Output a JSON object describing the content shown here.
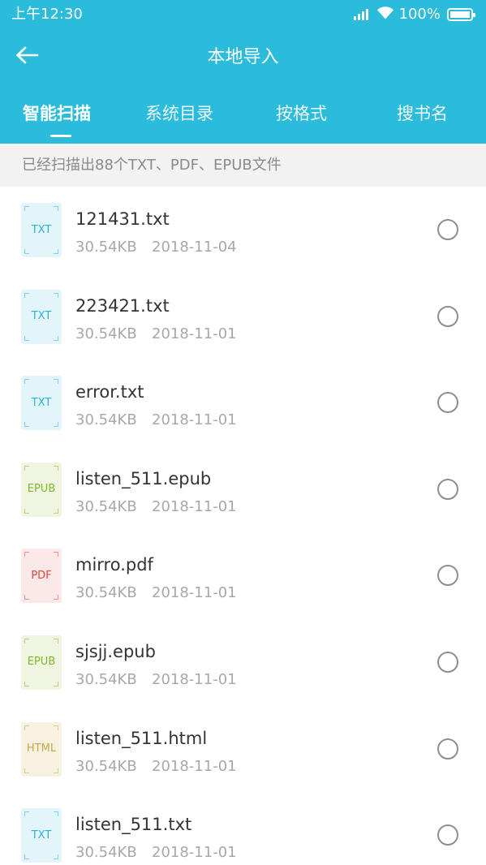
{
  "status_bar": {
    "time": "上午12:30",
    "battery": "100%",
    "icons": [
      "signal-icon",
      "wifi-icon",
      "battery-icon"
    ]
  },
  "header": {
    "title": "本地导入",
    "back_icon": "arrow-left-icon",
    "background_color": "#2bbcdc"
  },
  "tabs": [
    {
      "label": "智能扫描",
      "active": true
    },
    {
      "label": "系统目录",
      "active": false
    },
    {
      "label": "按格式",
      "active": false
    },
    {
      "label": "搜书名",
      "active": false
    }
  ],
  "summary": "已经扫描出88个TXT、PDF、EPUB文件",
  "files": [
    {
      "type": "TXT",
      "name": "121431.txt",
      "size": "30.54KB",
      "date": "2018-11-04",
      "checked": false
    },
    {
      "type": "TXT",
      "name": "223421.txt",
      "size": "30.54KB",
      "date": "2018-11-01",
      "checked": false
    },
    {
      "type": "TXT",
      "name": "error.txt",
      "size": "30.54KB",
      "date": "2018-11-01",
      "checked": false
    },
    {
      "type": "EPUB",
      "name": "listen_511.epub",
      "size": "30.54KB",
      "date": "2018-11-01",
      "checked": false
    },
    {
      "type": "PDF",
      "name": "mirro.pdf",
      "size": "30.54KB",
      "date": "2018-11-01",
      "checked": false
    },
    {
      "type": "EPUB",
      "name": "sjsjj.epub",
      "size": "30.54KB",
      "date": "2018-11-01",
      "checked": false
    },
    {
      "type": "HTML",
      "name": "listen_511.html",
      "size": "30.54KB",
      "date": "2018-11-01",
      "checked": false
    },
    {
      "type": "TXT",
      "name": "listen_511.txt",
      "size": "30.54KB",
      "date": "2018-11-01",
      "checked": false
    }
  ],
  "file_type_colors": {
    "TXT": {
      "bg": "#e3f4fa",
      "fg": "#2bb3d4"
    },
    "EPUB": {
      "bg": "#eff5e0",
      "fg": "#7cb82a"
    },
    "PDF": {
      "bg": "#fbe9e9",
      "fg": "#e0443c"
    },
    "HTML": {
      "bg": "#f6f1e0",
      "fg": "#c8a64a"
    }
  }
}
